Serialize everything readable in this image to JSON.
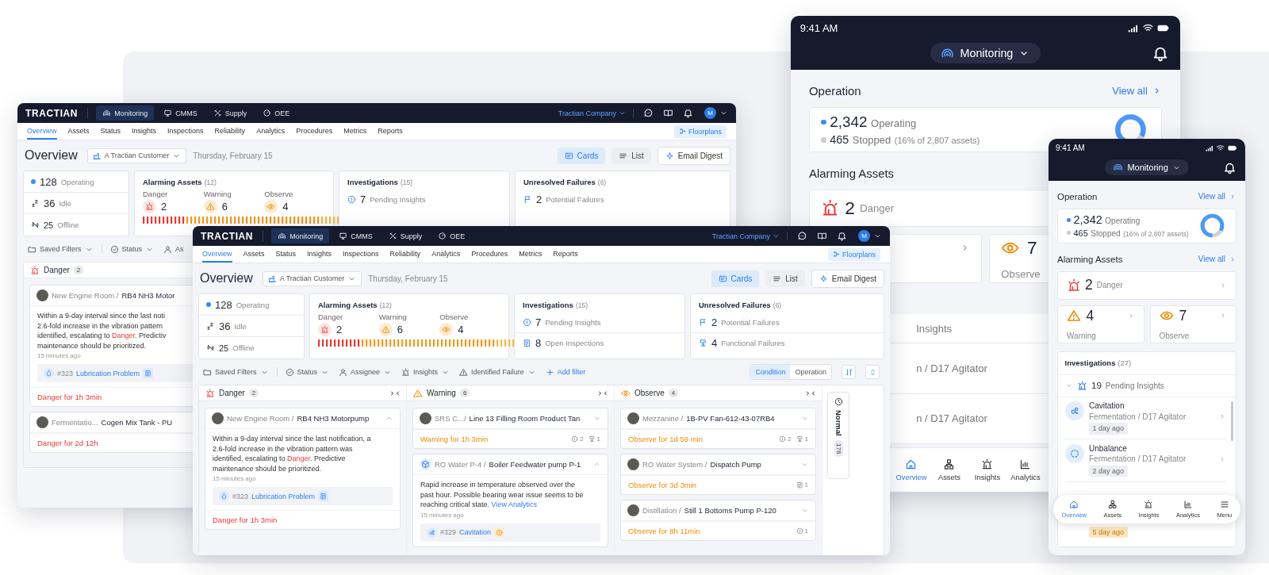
{
  "desktop_back": {
    "logo": "TRACTIAN",
    "modules": [
      {
        "label": "Monitoring",
        "kind": "monitoring",
        "selected": true
      },
      {
        "label": "CMMS",
        "kind": "cmms",
        "selected": false
      },
      {
        "label": "Supply",
        "kind": "supply",
        "selected": false
      },
      {
        "label": "OEE",
        "kind": "oee",
        "selected": false
      }
    ],
    "company": "Tractian Company",
    "avatar": "M",
    "tabs": [
      {
        "label": "Overview",
        "selected": true
      },
      {
        "label": "Assets",
        "selected": false
      },
      {
        "label": "Status",
        "selected": false
      },
      {
        "label": "Insights",
        "selected": false
      },
      {
        "label": "Inspections",
        "selected": false
      },
      {
        "label": "Reliability",
        "selected": false
      },
      {
        "label": "Analytics",
        "selected": false
      },
      {
        "label": "Procedures",
        "selected": false
      },
      {
        "label": "Metrics",
        "selected": false
      },
      {
        "label": "Reports",
        "selected": false
      }
    ],
    "floorplans": "Floorplans",
    "title": "Overview",
    "site": "A Tractian Customer",
    "date": "Thursday, February 15",
    "views": [
      {
        "label": "Cards",
        "kind": "cards",
        "selected": true
      },
      {
        "label": "List",
        "kind": "list",
        "selected": false
      }
    ],
    "digest": "Email Digest",
    "status": [
      {
        "kind": "operating",
        "value": "128",
        "label": "Operating"
      },
      {
        "kind": "idle",
        "value": "36",
        "label": "Idle"
      },
      {
        "kind": "offline",
        "value": "25",
        "label": "Offline"
      }
    ],
    "alarming": {
      "title": "Alarming Assets",
      "count": "(12)",
      "levels": [
        {
          "kind": "danger",
          "label": "Danger",
          "value": "2"
        },
        {
          "kind": "warning",
          "label": "Warning",
          "value": "6"
        },
        {
          "kind": "observe",
          "label": "Observe",
          "value": "4"
        }
      ]
    },
    "investigations": {
      "title": "Investigations",
      "count": "(15)",
      "items": [
        {
          "kind": "insight",
          "value": "7",
          "label": "Pending Insights"
        }
      ]
    },
    "failures": {
      "title": "Unresolved Failures",
      "count": "(6)",
      "items": [
        {
          "kind": "potential",
          "value": "2",
          "label": "Potential Failures"
        }
      ]
    },
    "filters": [
      {
        "kind": "saved",
        "label": "Saved Filters",
        "dropdown": true
      },
      {
        "kind": "status",
        "label": "Status",
        "dropdown": true
      },
      {
        "kind": "assignee",
        "label": "As",
        "dropdown": false
      }
    ],
    "columns": [
      {
        "kind": "danger",
        "title": "Danger",
        "count": "2",
        "cards": [
          {
            "kind": "photo",
            "location": "New Engine Room /",
            "asset": "RB4 NH3 Motor",
            "body": [
              [
                {
                  "text": "Within a 9-day interval since the last noti"
                }
              ],
              [
                {
                  "text": "2.6-fold increase in the vibration pattern"
                }
              ],
              [
                {
                  "text": "identified, escalating to "
                },
                {
                  "text": "Danger",
                  "kind": "alert"
                },
                {
                  "text": ". Predictiv"
                }
              ],
              [
                {
                  "text": "maintenance should be prioritized."
                }
              ]
            ],
            "time": "15 minutes ago",
            "chip": {
              "kind": "lubrication",
              "number": "#323",
              "label": "Lubrication Problem"
            },
            "footer": "Danger for 1h 3min"
          },
          {
            "kind": "photo",
            "location": "Fermentatio...",
            "asset": "Cogen Mix Tank - PU",
            "footer": "Danger for 2d 12h"
          }
        ]
      }
    ]
  },
  "mobile_large": {
    "time": "9:41 AM",
    "module": "Monitoring",
    "operation": {
      "title": "Operation",
      "link": "View all",
      "operating": {
        "value": "2,342",
        "label": "Operating"
      },
      "stopped": {
        "value": "465",
        "label": "Stopped",
        "note": "(16% of 2,807 assets)"
      }
    },
    "alarming": {
      "title": "Alarming Assets",
      "cards": [
        {
          "kind": "danger",
          "value": "2",
          "label": "Danger"
        },
        {
          "kind": "warning"
        },
        {
          "kind": "observe",
          "value": "7",
          "label": "Observe"
        }
      ]
    },
    "rows": [
      "Insights",
      "n / D17 Agitator",
      "n / D17 Agitator"
    ],
    "nav": [
      {
        "kind": "overview",
        "label": "Overview",
        "selected": true
      },
      {
        "kind": "assets",
        "label": "Assets",
        "selected": false
      },
      {
        "kind": "insights",
        "label": "Insights",
        "selected": false
      },
      {
        "kind": "analytics",
        "label": "Analytics",
        "selected": false
      }
    ]
  },
  "desktop_front": {
    "logo": "TRACTIAN",
    "modules": [
      {
        "label": "Monitoring",
        "kind": "monitoring",
        "selected": true
      },
      {
        "label": "CMMS",
        "kind": "cmms",
        "selected": false
      },
      {
        "label": "Supply",
        "kind": "supply",
        "selected": false
      },
      {
        "label": "OEE",
        "kind": "oee",
        "selected": false
      }
    ],
    "company": "Tractian Company",
    "avatar": "M",
    "tabs": [
      {
        "label": "Overview",
        "selected": true
      },
      {
        "label": "Assets",
        "selected": false
      },
      {
        "label": "Status",
        "selected": false
      },
      {
        "label": "Insights",
        "selected": false
      },
      {
        "label": "Inspections",
        "selected": false
      },
      {
        "label": "Reliability",
        "selected": false
      },
      {
        "label": "Analytics",
        "selected": false
      },
      {
        "label": "Procedures",
        "selected": false
      },
      {
        "label": "Metrics",
        "selected": false
      },
      {
        "label": "Reports",
        "selected": false
      }
    ],
    "floorplans": "Floorplans",
    "title": "Overview",
    "site": "A Tractian Customer",
    "date": "Thursday, February 15",
    "views": [
      {
        "label": "Cards",
        "kind": "cards",
        "selected": true
      },
      {
        "label": "List",
        "kind": "list",
        "selected": false
      }
    ],
    "digest": "Email Digest",
    "status": [
      {
        "kind": "operating",
        "value": "128",
        "label": "Operating"
      },
      {
        "kind": "idle",
        "value": "36",
        "label": "Idle"
      },
      {
        "kind": "offline",
        "value": "25",
        "label": "Offline"
      }
    ],
    "alarming": {
      "title": "Alarming Assets",
      "count": "(12)",
      "levels": [
        {
          "kind": "danger",
          "label": "Danger",
          "value": "2"
        },
        {
          "kind": "warning",
          "label": "Warning",
          "value": "6"
        },
        {
          "kind": "observe",
          "label": "Observe",
          "value": "4"
        }
      ]
    },
    "investigations": {
      "title": "Investigations",
      "count": "(15)",
      "items": [
        {
          "kind": "insight",
          "value": "7",
          "label": "Pending Insights"
        },
        {
          "kind": "inspection",
          "value": "8",
          "label": "Open Inspections"
        }
      ]
    },
    "failures": {
      "title": "Unresolved Failures",
      "count": "(6)",
      "items": [
        {
          "kind": "potential",
          "value": "2",
          "label": "Potential Failures"
        },
        {
          "kind": "functional",
          "value": "4",
          "label": "Functional Failures"
        }
      ]
    },
    "filters": [
      {
        "kind": "saved",
        "label": "Saved Filters",
        "dropdown": true
      },
      {
        "kind": "status",
        "label": "Status",
        "dropdown": true
      },
      {
        "kind": "assignee",
        "label": "Assignee",
        "dropdown": true
      },
      {
        "kind": "insights",
        "label": "Insights",
        "dropdown": true
      },
      {
        "kind": "failure",
        "label": "Identified Failure",
        "dropdown": true
      },
      {
        "kind": "add",
        "label": "Add filter",
        "dropdown": false
      }
    ],
    "modes": [
      {
        "label": "Condition",
        "selected": true
      },
      {
        "label": "Operation",
        "selected": false
      }
    ],
    "columns": [
      {
        "kind": "danger",
        "title": "Danger",
        "count": "2",
        "collapsible": true,
        "cards": [
          {
            "kind": "photo",
            "location": "New Engine Room /",
            "asset": "RB4 NH3 Motorpump",
            "expanded": true,
            "body": [
              [
                {
                  "text": "Within a 9-day interval since the last notification, a"
                }
              ],
              [
                {
                  "text": "2.6-fold increase in the vibration pattern was"
                }
              ],
              [
                {
                  "text": "identified, escalating to "
                },
                {
                  "text": "Danger",
                  "kind": "alert"
                },
                {
                  "text": ". Predictive"
                }
              ],
              [
                {
                  "text": "maintenance should be prioritized."
                }
              ]
            ],
            "time": "15 minutes ago",
            "chip": {
              "kind": "lubrication",
              "number": "#323",
              "label": "Lubrication Problem"
            },
            "footer": "Danger for 1h 3min"
          }
        ]
      },
      {
        "kind": "warning",
        "title": "Warning",
        "count": "6",
        "collapsible": true,
        "cards": [
          {
            "kind": "photo",
            "location": "SRS C.../",
            "asset": "Line 13 Filling Room Product Tan",
            "expanded": false,
            "footer": "Warning for 1h 3min",
            "counts": [
              {
                "kind": "insight",
                "value": "2"
              },
              {
                "kind": "failure",
                "value": "1"
              }
            ]
          },
          {
            "kind": "cube",
            "location": "RO Water P-4 /",
            "asset": "Boiler Feedwater pump P-1",
            "expanded": true,
            "body": [
              [
                {
                  "text": "Rapid increase in temperature observed over the"
                }
              ],
              [
                {
                  "text": "past hour. Possible bearing wear issue seems to be"
                }
              ],
              [
                {
                  "text": "reaching critical state. "
                },
                {
                  "text": "View Analytics",
                  "kind": "link"
                }
              ]
            ],
            "time": "15 minutes ago",
            "chip": {
              "kind": "cavitation",
              "number": "#329",
              "label": "Cavitation"
            }
          }
        ]
      },
      {
        "kind": "observe",
        "title": "Observe",
        "count": "4",
        "collapsible": true,
        "cards": [
          {
            "kind": "photo",
            "location": "Mezzanine /",
            "asset": "1B-PV Fan-612-43-07RB4",
            "expanded": false,
            "footer": "Observe for 1d 59 min",
            "counts": [
              {
                "kind": "insight",
                "value": "2"
              },
              {
                "kind": "failure",
                "value": "1"
              }
            ]
          },
          {
            "kind": "photo",
            "location": "RO Water System /",
            "asset": "Dispatch Pump",
            "expanded": false,
            "footer": "Observe for 3d 3min",
            "counts": [
              {
                "kind": "inspection",
                "value": "1"
              }
            ]
          },
          {
            "kind": "photo",
            "location": "Distillation /",
            "asset": "Still 1 Bottoms Pump P-120",
            "expanded": false,
            "footer": "Observe for 8h 11min",
            "counts": [
              {
                "kind": "insight",
                "value": "1"
              }
            ]
          }
        ]
      }
    ],
    "normal": {
      "label": "Normal",
      "count": "176"
    }
  },
  "mobile_small": {
    "time": "9:41 AM",
    "module": "Monitoring",
    "operation": {
      "title": "Operation",
      "link": "View all",
      "operating": {
        "value": "2,342",
        "label": "Operating"
      },
      "stopped": {
        "value": "465",
        "label": "Stopped",
        "note": "(16% of 2,807 assets)"
      }
    },
    "alarming": {
      "title": "Alarming Assets",
      "link": "View all",
      "cards": [
        {
          "kind": "danger",
          "value": "2",
          "label": "Danger"
        },
        {
          "kind": "warning",
          "value": "4",
          "label": "Warning"
        },
        {
          "kind": "observe",
          "value": "7",
          "label": "Observe"
        }
      ]
    },
    "investigations": {
      "title": "Investigations",
      "count": "(27)",
      "pending": {
        "value": "19",
        "label": "Pending Insights",
        "expanded": true
      },
      "items": [
        {
          "kind": "cavitation",
          "title": "Cavitation",
          "subtitle": "Fermentation / D17 Agitator",
          "age": "1 day ago",
          "overdue": false
        },
        {
          "kind": "unbalance",
          "title": "Unbalance",
          "subtitle": "Fermentation / D17 Agitator",
          "age": "2 day ago",
          "overdue": false
        },
        {
          "age": "5 day ago",
          "overdue": true
        }
      ]
    },
    "nav": [
      {
        "kind": "overview",
        "label": "Overview",
        "selected": true
      },
      {
        "kind": "assets",
        "label": "Assets",
        "selected": false
      },
      {
        "kind": "insights",
        "label": "Insights",
        "selected": false
      },
      {
        "kind": "analytics",
        "label": "Analytics",
        "selected": false
      },
      {
        "kind": "menu",
        "label": "Menu",
        "selected": false
      }
    ]
  }
}
